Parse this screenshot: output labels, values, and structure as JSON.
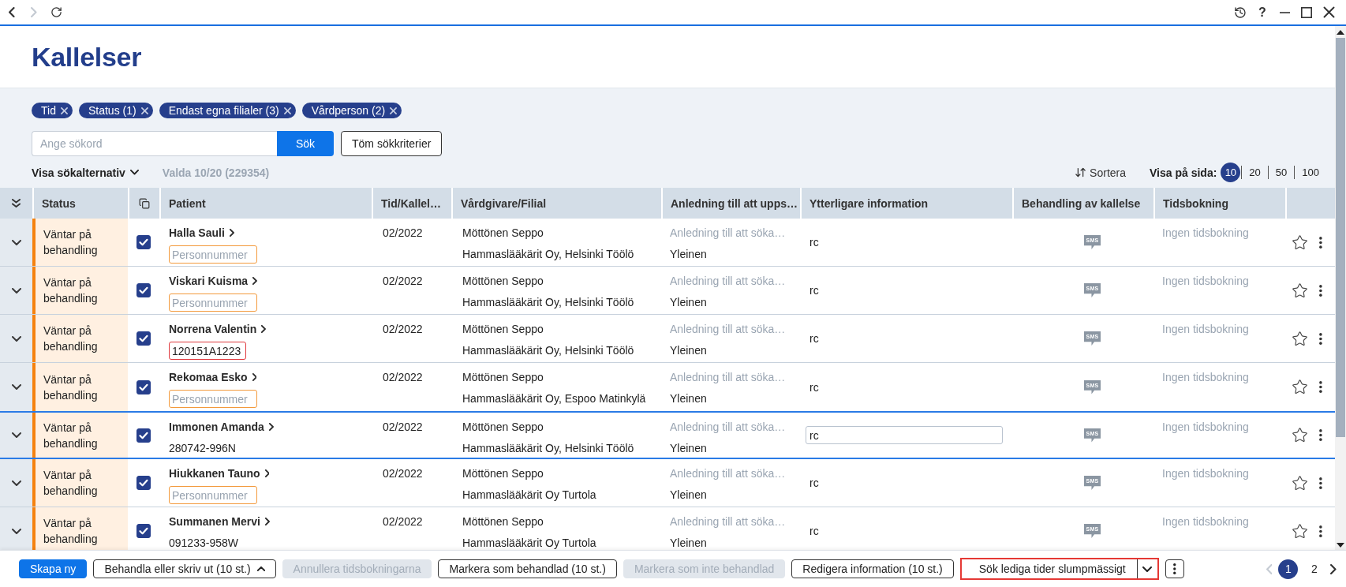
{
  "top_bar": {
    "back": {
      "disabled": false
    },
    "forward": {
      "disabled": true
    },
    "help": "?"
  },
  "title": "Kallelser",
  "filter_chips": [
    {
      "label": "Tid"
    },
    {
      "label": "Status (1)"
    },
    {
      "label": "Endast egna filialer (3)"
    },
    {
      "label": "Vårdperson (2)"
    }
  ],
  "search": {
    "placeholder": "Ange sökord",
    "button": "Sök"
  },
  "clear_button": "Töm sökkriterier",
  "options_toggle": {
    "label": "Visa sökalternativ",
    "expanded": false
  },
  "selection_summary": "Valda 10/20 (229354)",
  "sort_button": "Sortera",
  "page_size": {
    "label": "Visa på sida:",
    "options": [
      {
        "label": "10",
        "selected": true
      },
      {
        "label": "20",
        "selected": false
      },
      {
        "label": "50",
        "selected": false
      },
      {
        "label": "100",
        "selected": false
      }
    ]
  },
  "table": {
    "columns": [
      "Status",
      "Patient",
      "Tid/Kallel…",
      "Vårdgivare/Filial",
      "Anledning till att upps…",
      "Ytterligare information",
      "Behandling av kallelse",
      "Tidsbokning"
    ],
    "rows": [
      {
        "selected": false,
        "expanded": false,
        "status": {
          "label": "Väntar på behandling",
          "kind": "pending"
        },
        "checked": true,
        "patient": "Halla Sauli",
        "personnummer": {
          "kind": "empty",
          "placeholder": "Personnummer"
        },
        "time": "02/2022",
        "provider": "Möttönen Seppo",
        "branch": "Hammaslääkärit Oy, Helsinki Töölö",
        "reason": "Anledning till att söka…",
        "category": "Yleinen",
        "info": {
          "kind": "text",
          "value": "rc"
        },
        "treatment": {
          "kind": "sms",
          "label": "SMS"
        },
        "booking": "Ingen tidsbokning",
        "starred": false
      },
      {
        "selected": false,
        "expanded": false,
        "status": {
          "label": "Väntar på behandling",
          "kind": "pending"
        },
        "checked": true,
        "patient": "Viskari Kuisma",
        "personnummer": {
          "kind": "empty",
          "placeholder": "Personnummer"
        },
        "time": "02/2022",
        "provider": "Möttönen Seppo",
        "branch": "Hammaslääkärit Oy, Helsinki Töölö",
        "reason": "Anledning till att söka…",
        "category": "Yleinen",
        "info": {
          "kind": "text",
          "value": "rc"
        },
        "treatment": {
          "kind": "sms",
          "label": "SMS"
        },
        "booking": "Ingen tidsbokning",
        "starred": false
      },
      {
        "selected": false,
        "expanded": false,
        "status": {
          "label": "Väntar på behandling",
          "kind": "pending"
        },
        "checked": true,
        "patient": "Norrena Valentin",
        "personnummer": {
          "kind": "error",
          "value": "120151A1223"
        },
        "time": "02/2022",
        "provider": "Möttönen Seppo",
        "branch": "Hammaslääkärit Oy, Helsinki Töölö",
        "reason": "Anledning till att söka…",
        "category": "Yleinen",
        "info": {
          "kind": "text",
          "value": "rc"
        },
        "treatment": {
          "kind": "sms",
          "label": "SMS"
        },
        "booking": "Ingen tidsbokning",
        "starred": false
      },
      {
        "selected": false,
        "expanded": false,
        "status": {
          "label": "Väntar på behandling",
          "kind": "pending"
        },
        "checked": true,
        "patient": "Rekomaa Esko",
        "personnummer": {
          "kind": "empty",
          "placeholder": "Personnummer"
        },
        "time": "02/2022",
        "provider": "Möttönen Seppo",
        "branch": "Hammaslääkärit Oy, Espoo Matinkylä",
        "reason": "Anledning till att söka…",
        "category": "Yleinen",
        "info": {
          "kind": "text",
          "value": "rc"
        },
        "treatment": {
          "kind": "sms",
          "label": "SMS"
        },
        "booking": "Ingen tidsbokning",
        "starred": false
      },
      {
        "selected": true,
        "expanded": false,
        "status": {
          "label": "Väntar på behandling",
          "kind": "pending"
        },
        "checked": true,
        "patient": "Immonen Amanda",
        "personnummer": {
          "kind": "text",
          "value": "280742-996N"
        },
        "time": "02/2022",
        "provider": "Möttönen Seppo",
        "branch": "Hammaslääkärit Oy, Helsinki Töölö",
        "reason": "Anledning till att söka…",
        "category": "Yleinen",
        "info": {
          "kind": "field",
          "value": "rc"
        },
        "treatment": {
          "kind": "sms",
          "label": "SMS"
        },
        "booking": "Ingen tidsbokning",
        "starred": false
      },
      {
        "selected": false,
        "expanded": false,
        "status": {
          "label": "Väntar på behandling",
          "kind": "pending"
        },
        "checked": true,
        "patient": "Hiukkanen Tauno",
        "personnummer": {
          "kind": "empty",
          "placeholder": "Personnummer"
        },
        "time": "02/2022",
        "provider": "Möttönen Seppo",
        "branch": "Hammaslääkärit Oy Turtola",
        "reason": "Anledning till att söka…",
        "category": "Yleinen",
        "info": {
          "kind": "text",
          "value": "rc"
        },
        "treatment": {
          "kind": "sms",
          "label": "SMS"
        },
        "booking": "Ingen tidsbokning",
        "starred": false
      },
      {
        "selected": false,
        "expanded": false,
        "status": {
          "label": "Väntar på behandling",
          "kind": "pending"
        },
        "checked": true,
        "patient": "Summanen Mervi",
        "personnummer": {
          "kind": "text",
          "value": "091233-958W"
        },
        "time": "02/2022",
        "provider": "Möttönen Seppo",
        "branch": "Hammaslääkärit Oy Turtola",
        "reason": "Anledning till att söka…",
        "category": "Yleinen",
        "info": {
          "kind": "text",
          "value": "rc"
        },
        "treatment": {
          "kind": "sms",
          "label": "SMS"
        },
        "booking": "Ingen tidsbokning",
        "starred": false
      }
    ]
  },
  "actions": [
    {
      "kind": "primary",
      "label": "Skapa ny",
      "disabled": false,
      "highlighted": false
    },
    {
      "kind": "dropup",
      "label": "Behandla eller skriv ut (10 st.)",
      "disabled": false,
      "highlighted": false
    },
    {
      "kind": "outline",
      "label": "Annullera tidsbokningarna",
      "disabled": true,
      "highlighted": false
    },
    {
      "kind": "outline",
      "label": "Markera som behandlad (10 st.)",
      "disabled": false,
      "highlighted": false
    },
    {
      "kind": "outline",
      "label": "Markera som inte behandlad",
      "disabled": true,
      "highlighted": false
    },
    {
      "kind": "outline",
      "label": "Redigera information (10 st.)",
      "disabled": false,
      "highlighted": false
    },
    {
      "kind": "split",
      "label": "Sök lediga tider slumpmässigt",
      "disabled": false,
      "highlighted": true
    },
    {
      "kind": "more",
      "disabled": false,
      "highlighted": false
    }
  ],
  "pagination": {
    "previous": {
      "disabled": true
    },
    "pages": [
      {
        "label": "1",
        "selected": true
      },
      {
        "label": "2",
        "selected": false
      }
    ],
    "next": {
      "disabled": false
    }
  }
}
